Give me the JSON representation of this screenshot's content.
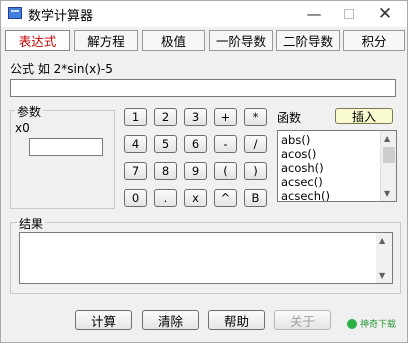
{
  "window": {
    "title": "数学计算器"
  },
  "titlebar": {
    "min": "—",
    "close": "✕"
  },
  "tabs": [
    "表达式",
    "解方程",
    "极值",
    "一阶导数",
    "二阶导数",
    "积分"
  ],
  "formula": {
    "label": "公式 如 2*sin(x)-5",
    "value": ""
  },
  "params": {
    "title": "参数",
    "x0_label": "x0",
    "x0_value": ""
  },
  "keypad": [
    [
      "1",
      "2",
      "3",
      "+",
      "*"
    ],
    [
      "4",
      "5",
      "6",
      "-",
      "/"
    ],
    [
      "7",
      "8",
      "9",
      "(",
      ")"
    ],
    [
      "0",
      ".",
      "x",
      "^",
      "B"
    ]
  ],
  "functions": {
    "label": "函数",
    "insert_button": "插入",
    "items": [
      "abs()",
      "acos()",
      "acosh()",
      "acsec()",
      "acsech()"
    ]
  },
  "result": {
    "title": "结果",
    "value": ""
  },
  "buttons": {
    "calc": "计算",
    "clear": "清除",
    "help": "帮助",
    "about": "关于"
  },
  "watermark": "神奇下载",
  "colors": {
    "active_tab": "#c00000",
    "insert_button_bg": "#fafad0"
  }
}
